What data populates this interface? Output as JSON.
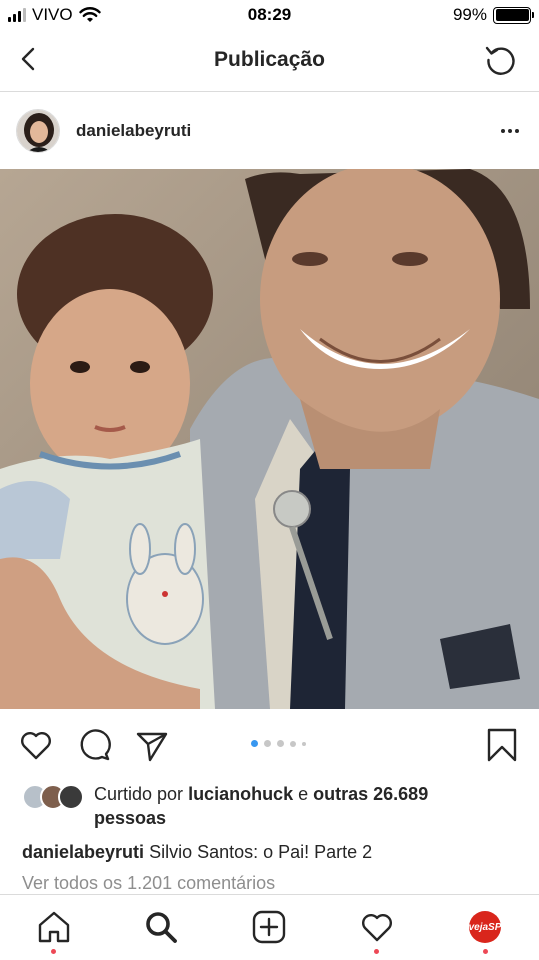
{
  "status_bar": {
    "carrier": "VIVO",
    "time": "08:29",
    "battery_percent": "99%",
    "battery_level": 0.99,
    "icons": [
      "signal-icon",
      "wifi-icon",
      "battery-icon"
    ]
  },
  "header": {
    "title": "Publicação",
    "icons": [
      "back-icon",
      "refresh-icon"
    ]
  },
  "post": {
    "username": "danielabeyruti",
    "icons": [
      "more-options-icon"
    ],
    "photo_description_icon": "photo-image",
    "carousel": {
      "total": 5,
      "current": 1
    },
    "actions": [
      "heart-icon",
      "comment-icon",
      "share-icon",
      "bookmark-icon"
    ],
    "likes": {
      "prefix": "Curtido por",
      "user": "lucianohuck",
      "joiner": "e",
      "others": "outras 26.689",
      "suffix": "pessoas"
    },
    "caption": {
      "username": "danielabeyruti",
      "text": "Silvio Santos: o Pai! Parte 2"
    },
    "view_comments": "Ver todos os 1.201 comentários"
  },
  "tabbar": {
    "tabs": [
      "home-icon",
      "search-icon",
      "new-post-icon",
      "activity-icon",
      "profile-icon"
    ],
    "profile_badge": "vejaSP"
  },
  "colors": {
    "notification_dot": "#ed4956",
    "divider": "#dbdbdb",
    "secondary_text": "#8e8e8e",
    "active_dot": "#3897f0"
  }
}
